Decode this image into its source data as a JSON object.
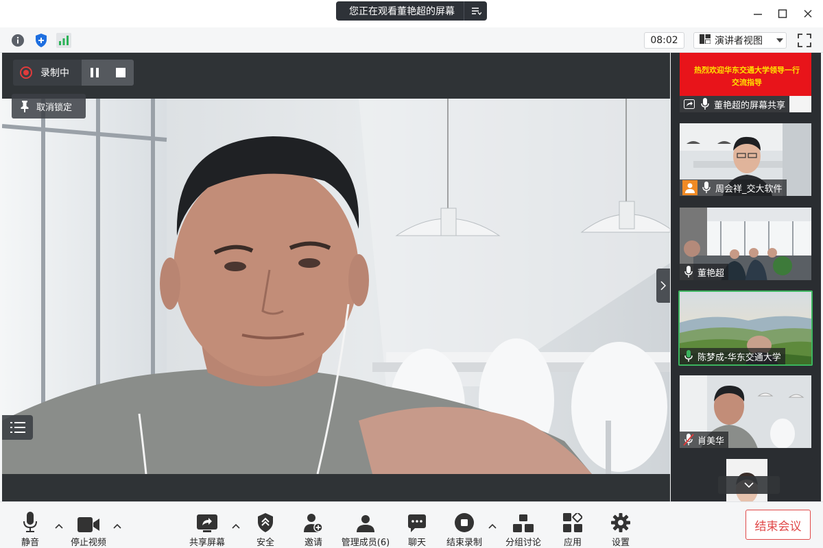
{
  "title_bar": {
    "share_banner": "您正在观看董艳超的屏幕"
  },
  "info_bar": {
    "timer": "08:02",
    "view_mode": "演讲者视图"
  },
  "stage": {
    "recording_label": "录制中",
    "unpin_label": "取消锁定"
  },
  "gallery": {
    "banner_line1": "热烈欢迎华东交通大学领导一行",
    "banner_line2": "交流指导",
    "tiles": [
      {
        "name": "董艳超的屏幕共享"
      },
      {
        "name": "周会祥_交大软件"
      },
      {
        "name": "董艳超"
      },
      {
        "name": "陈梦成-华东交通大学"
      },
      {
        "name": "肖美华"
      }
    ]
  },
  "toolbar": {
    "mute": "静音",
    "stop_video": "停止视频",
    "share_screen": "共享屏幕",
    "security": "安全",
    "invite": "邀请",
    "manage_members": "管理成员(6)",
    "chat": "聊天",
    "end_recording": "结束录制",
    "breakout": "分组讨论",
    "apps": "应用",
    "settings": "设置",
    "end_meeting": "结束会议"
  },
  "colors": {
    "record_red": "#e03b3b",
    "end_meeting_red": "#e04848",
    "active_speaker_green": "#3bb45e",
    "avatar_orange": "#f08a24",
    "banner_red": "#e8141a"
  }
}
